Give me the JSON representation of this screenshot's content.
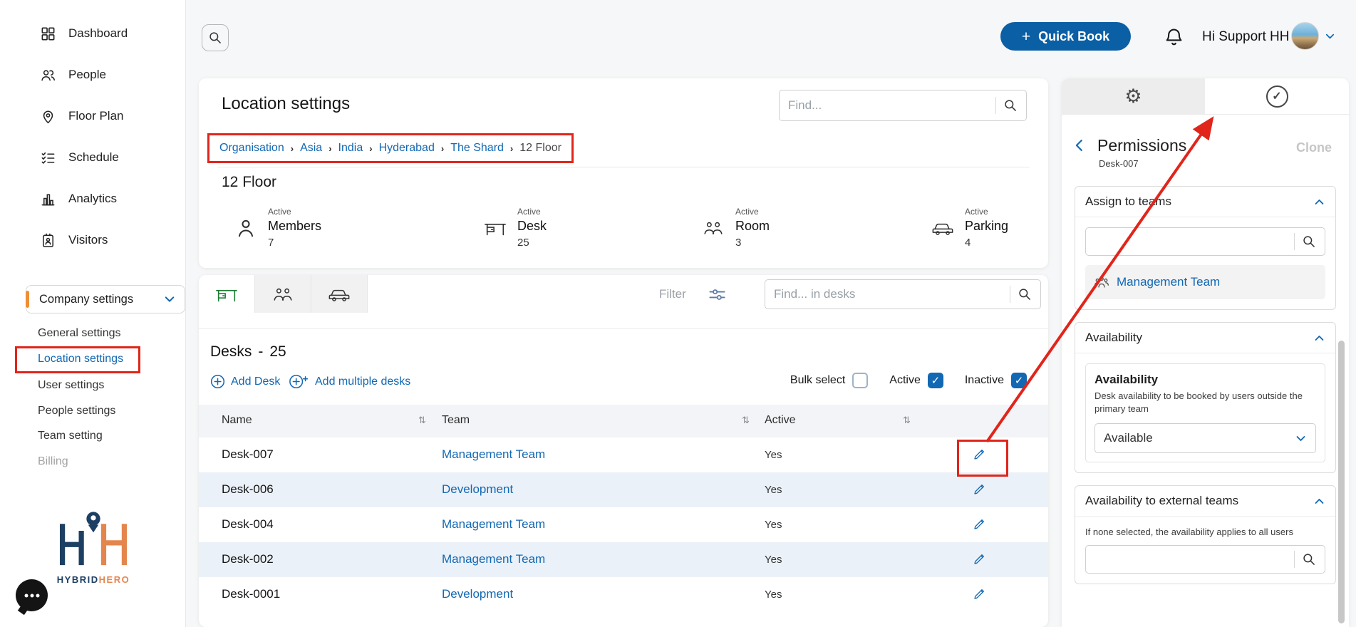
{
  "colors": {
    "accent": "#1268b3",
    "button_blue": "#0b5fa5",
    "annotation_red": "#e1251b",
    "desk_tab_green": "#1e7c33"
  },
  "icons": {
    "gear": "⚙",
    "check": "✓",
    "sort_icon": "⇅",
    "plus": "+",
    "breadcrumb_separator": "›",
    "dash": "-",
    "dots": ""
  },
  "sidebar": {
    "items": [
      {
        "label": "Dashboard"
      },
      {
        "label": "People"
      },
      {
        "label": "Floor Plan"
      },
      {
        "label": "Schedule"
      },
      {
        "label": "Analytics"
      },
      {
        "label": "Visitors"
      }
    ],
    "company_settings": {
      "label": "Company settings",
      "items": [
        {
          "label": "General settings"
        },
        {
          "label": "Location settings"
        },
        {
          "label": "User settings"
        },
        {
          "label": "People settings"
        },
        {
          "label": "Team setting"
        },
        {
          "label": "Billing"
        }
      ]
    },
    "logo": {
      "part1": "HYBRID",
      "part2": "HERO"
    }
  },
  "topbar": {
    "quick_book": "Quick Book",
    "greeting": "Hi Support HH"
  },
  "location_card": {
    "title": "Location settings",
    "find_placeholder": "Find...",
    "breadcrumb": [
      "Organisation",
      "Asia",
      "India",
      "Hyderabad",
      "The Shard",
      "12 Floor"
    ],
    "floor_title": "12 Floor",
    "stats": [
      {
        "tag": "Active",
        "label": "Members",
        "value": "7"
      },
      {
        "tag": "Active",
        "label": "Desk",
        "value": "25"
      },
      {
        "tag": "Active",
        "label": "Room",
        "value": "3"
      },
      {
        "tag": "Active",
        "label": "Parking",
        "value": "4"
      }
    ]
  },
  "desks_card": {
    "filter_label": "Filter",
    "find_placeholder": "Find... in desks",
    "title": "Desks",
    "count": "25",
    "add_desk": "Add Desk",
    "add_multiple": "Add multiple desks",
    "bulk_select": "Bulk select",
    "active": "Active",
    "inactive": "Inactive",
    "columns": {
      "name": "Name",
      "team": "Team",
      "active": "Active"
    },
    "rows": [
      {
        "name": "Desk-007",
        "team": "Management Team",
        "active": "Yes"
      },
      {
        "name": "Desk-006",
        "team": "Development",
        "active": "Yes"
      },
      {
        "name": "Desk-004",
        "team": "Management Team",
        "active": "Yes"
      },
      {
        "name": "Desk-002",
        "team": "Management Team",
        "active": "Yes"
      },
      {
        "name": "Desk-0001",
        "team": "Development",
        "active": "Yes"
      }
    ]
  },
  "permissions_panel": {
    "title": "Permissions",
    "subtitle": "Desk-007",
    "clone": "Clone",
    "assign": {
      "title": "Assign to teams",
      "team": "Management Team"
    },
    "availability": {
      "title": "Availability",
      "label": "Availability",
      "description": "Desk availability to be booked by users outside the primary team",
      "value": "Available"
    },
    "external": {
      "title": "Availability to external teams",
      "description": "If none selected, the availability applies to all users"
    }
  }
}
